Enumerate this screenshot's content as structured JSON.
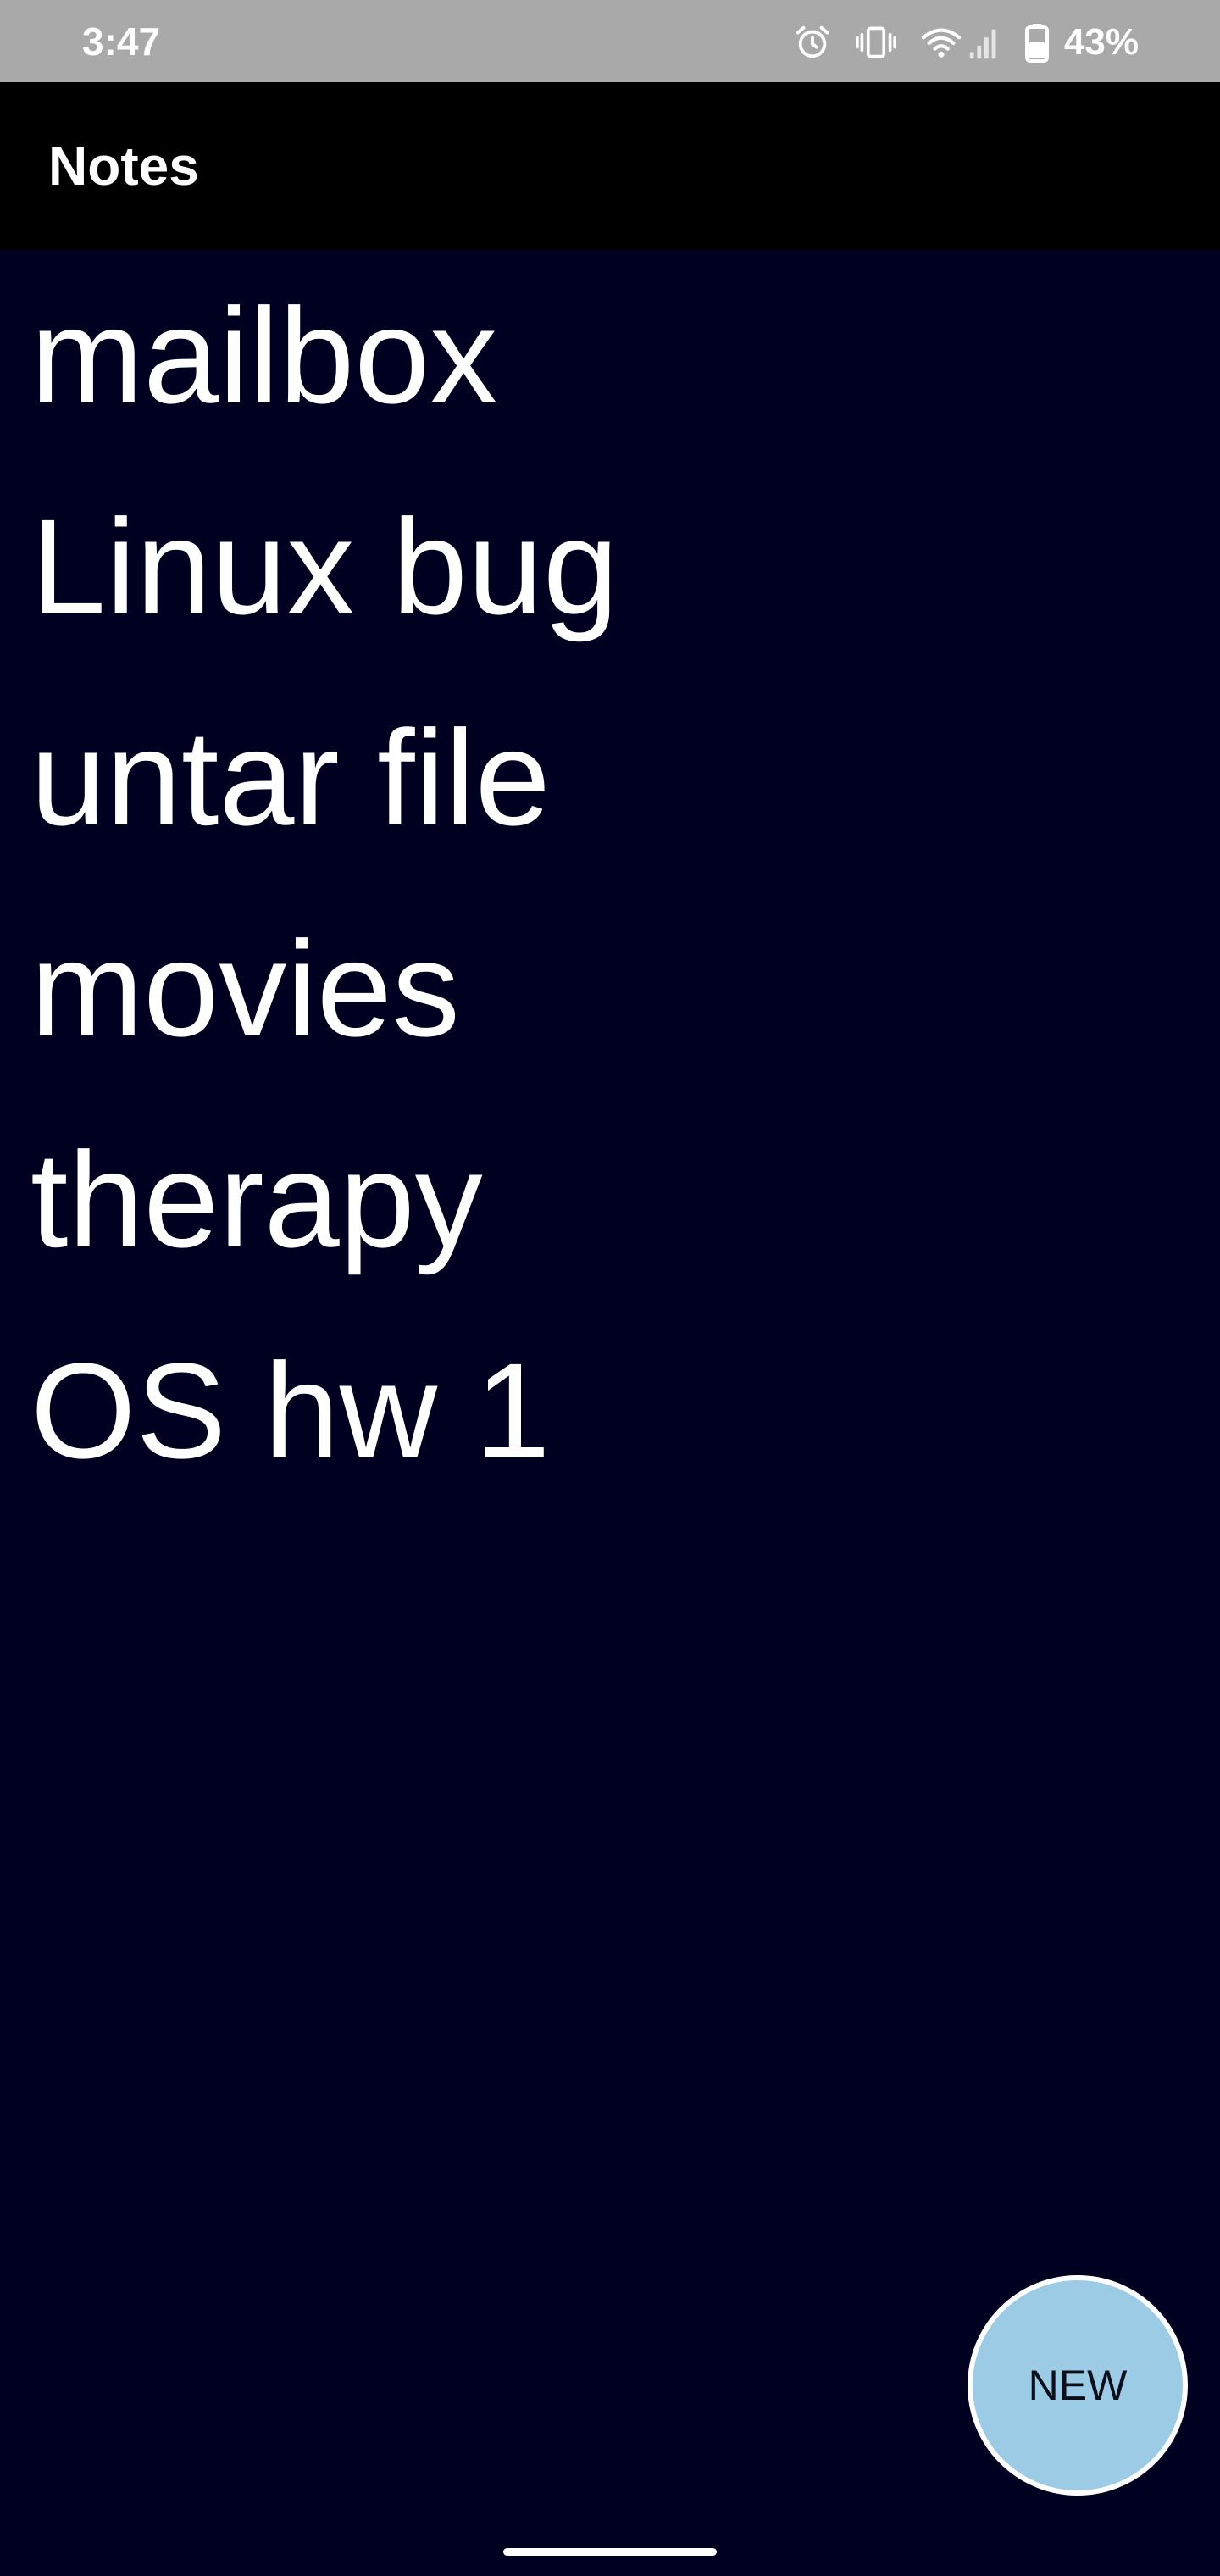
{
  "status_bar": {
    "time": "3:47",
    "icons": [
      "alarm-icon",
      "vibrate-icon",
      "wifi-icon",
      "signal-icon",
      "battery-icon"
    ],
    "battery_percent": "43%"
  },
  "app_bar": {
    "title": "Notes"
  },
  "notes": [
    {
      "title": "mailbox"
    },
    {
      "title": "Linux bug"
    },
    {
      "title": "untar file"
    },
    {
      "title": "movies"
    },
    {
      "title": "therapy"
    },
    {
      "title": "OS hw 1"
    }
  ],
  "fab": {
    "label": "NEW"
  },
  "colors": {
    "status_bar_bg": "#a9a9a9",
    "app_bar_bg": "#000000",
    "list_bg": "#000020",
    "text": "#ffffff",
    "fab_bg": "#9ccbe6"
  }
}
